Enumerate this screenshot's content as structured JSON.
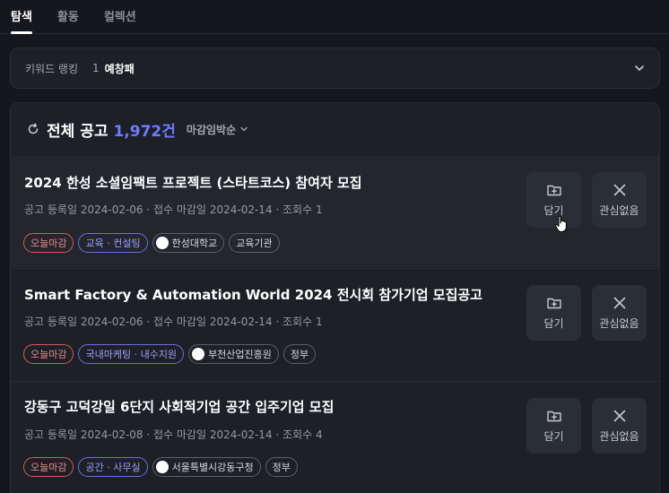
{
  "tabs": [
    {
      "label": "탐색",
      "active": true
    },
    {
      "label": "활동",
      "active": false
    },
    {
      "label": "컬렉션",
      "active": false
    }
  ],
  "keyword_ranking": {
    "title": "키워드 랭킹",
    "rank": "1",
    "keyword": "예창패"
  },
  "listing": {
    "total_label": "전체 공고",
    "total_count": "1,972건",
    "sort_label": "마감임박순"
  },
  "items": [
    {
      "title": "2024 한성 소셜임팩트 프로젝트 (스타트코스) 참여자 모집",
      "meta": "공고 등록일 2024-02-06 · 접수 마감일 2024-02-14 · 조회수 1",
      "deadline_tag": "오늘마감",
      "category_tag": "교육 · 컨설팅",
      "org_tag": "한성대학교",
      "type_tag": "교육기관",
      "save_label": "담기",
      "dismiss_label": "관심없음"
    },
    {
      "title": "Smart Factory & Automation World 2024 전시회 참가기업 모집공고",
      "meta": "공고 등록일 2024-02-06 · 접수 마감일 2024-02-14 · 조회수 1",
      "deadline_tag": "오늘마감",
      "category_tag": "국내마케팅 · 내수지원",
      "org_tag": "부천산업진흥원",
      "type_tag": "정부",
      "save_label": "담기",
      "dismiss_label": "관심없음"
    },
    {
      "title": "강동구 고덕강일 6단지 사회적기업 공간 입주기업 모집",
      "meta": "공고 등록일 2024-02-08 · 접수 마감일 2024-02-14 · 조회수 4",
      "deadline_tag": "오늘마감",
      "category_tag": "공간 · 사무실",
      "org_tag": "서울특별시강동구청",
      "type_tag": "정부",
      "save_label": "담기",
      "dismiss_label": "관심없음"
    }
  ],
  "colors": {
    "accent": "#6f7bff",
    "deadline": "#f08a8a",
    "category": "#9aa1ff",
    "background": "#15171c",
    "panel": "#1d2026"
  }
}
